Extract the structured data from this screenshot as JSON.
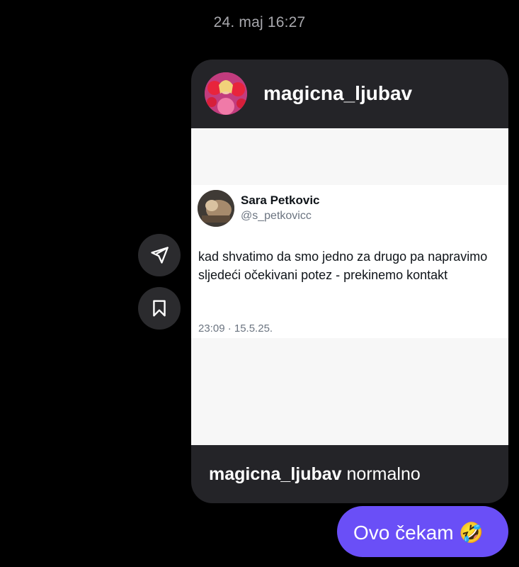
{
  "chat": {
    "timestamp": "24. maj 16:27"
  },
  "shared_post": {
    "username": "magicna_ljubav",
    "avatar_icon": "profile-photo-pink-roses",
    "tweet": {
      "name": "Sara Petkovic",
      "handle": "@s_petkovicc",
      "text": "kad shvatimo da smo jedno za drugo pa napravimo sljedeći očekivani potez - prekinemo kontakt",
      "time": "23:09 · 15.5.25."
    },
    "caption": {
      "username": "magicna_ljubav",
      "text": "normalno"
    }
  },
  "actions": {
    "share_icon": "paper-plane-icon",
    "save_icon": "bookmark-icon"
  },
  "my_message": {
    "text": "Ovo čekam 🤣"
  },
  "colors": {
    "background": "#000000",
    "bubble_dark": "#242428",
    "bubble_sent": "#6a4ff7",
    "timestamp": "#a8a8ad"
  }
}
